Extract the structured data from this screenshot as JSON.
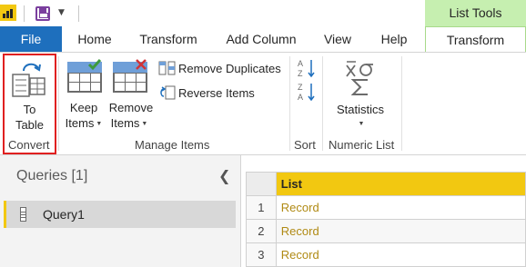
{
  "context_header": "List Tools",
  "tabs": {
    "file": "File",
    "home": "Home",
    "transform": "Transform",
    "add_column": "Add Column",
    "view": "View",
    "help": "Help",
    "list_transform": "Transform"
  },
  "ribbon": {
    "to_table_line1": "To",
    "to_table_line2": "Table",
    "convert_group": "Convert",
    "keep_items_line1": "Keep",
    "keep_items_line2": "Items",
    "remove_items_line1": "Remove",
    "remove_items_line2": "Items",
    "remove_duplicates": "Remove Duplicates",
    "reverse_items": "Reverse Items",
    "manage_items_group": "Manage Items",
    "sort_group": "Sort",
    "statistics": "Statistics",
    "numeric_list_group": "Numeric List"
  },
  "queries": {
    "title": "Queries [1]",
    "items": [
      "Query1"
    ]
  },
  "grid": {
    "column_header": "List",
    "rows": [
      {
        "num": "1",
        "value": "Record"
      },
      {
        "num": "2",
        "value": "Record"
      },
      {
        "num": "3",
        "value": "Record"
      }
    ]
  },
  "colors": {
    "file_tab": "#1e6fbd",
    "context_tab": "#c6efb0",
    "highlight": "#e02020",
    "column_header": "#f2c811",
    "record_text": "#b08a14"
  }
}
